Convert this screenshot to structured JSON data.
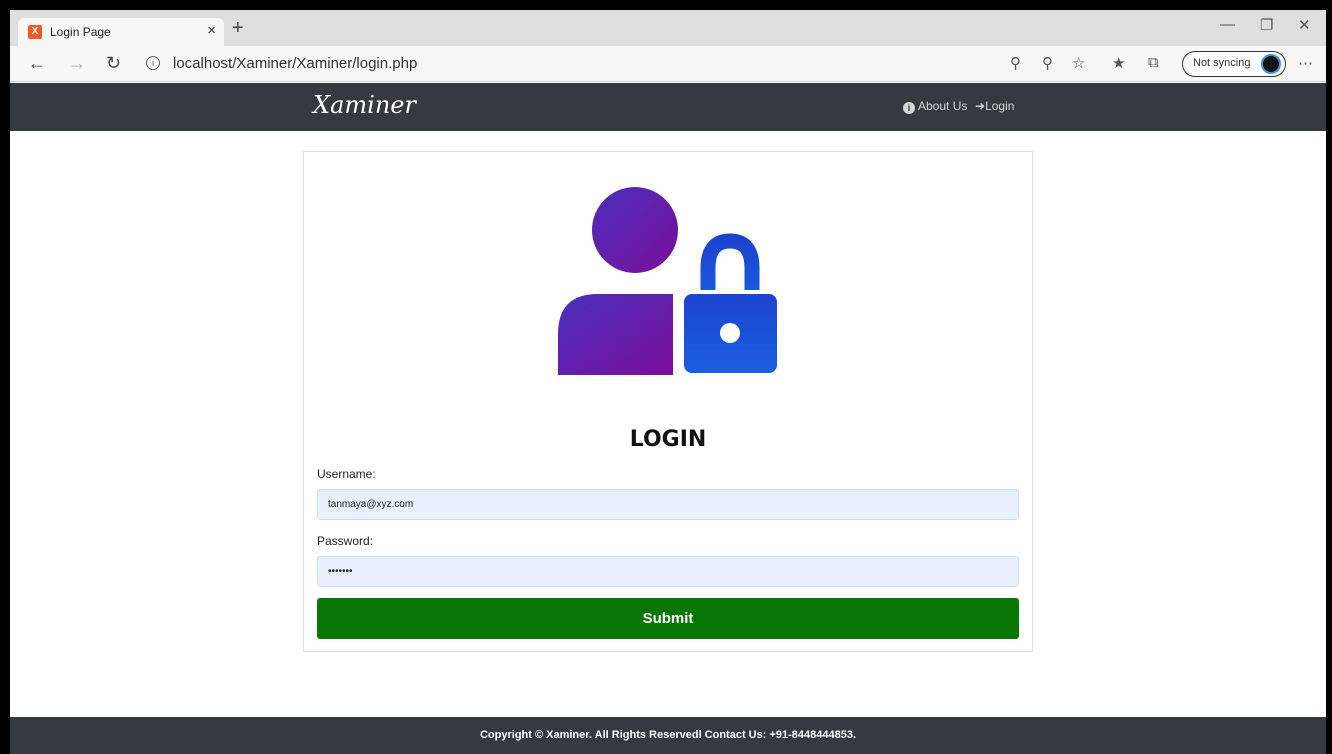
{
  "browser": {
    "tab_title": "Login Page",
    "tab_close": "×",
    "new_tab": "+",
    "favicon_text": "X",
    "url": "localhost/Xaminer/Xaminer/login.php",
    "sync_label": "Not syncing",
    "icons": [
      "back-arrow-icon",
      "forward-arrow-icon",
      "refresh-icon",
      "info-icon",
      "key-icon",
      "zoom-out-icon",
      "star-icon",
      "favorites-icon",
      "collections-icon",
      "more-icon"
    ]
  },
  "header": {
    "brand": "Xaminer",
    "about_label": "About Us",
    "login_label": "Login"
  },
  "form": {
    "title": "LOGIN",
    "username_label": "Username:",
    "username_value": "tanmaya@xyz.com",
    "password_label": "Password:",
    "password_value": "•••••••",
    "submit_label": "Submit"
  },
  "footer": {
    "text": "Copyright © Xaminer. All Rights Reservedl Contact Us: +91-8448444853."
  },
  "colors": {
    "header_bg": "#343a40",
    "submit_bg": "#087704",
    "input_bg": "#e8f0fe",
    "user_gradient_start": "#4a2fbd",
    "user_gradient_end": "#7a0f9a",
    "lock_color": "#1a56d9"
  }
}
